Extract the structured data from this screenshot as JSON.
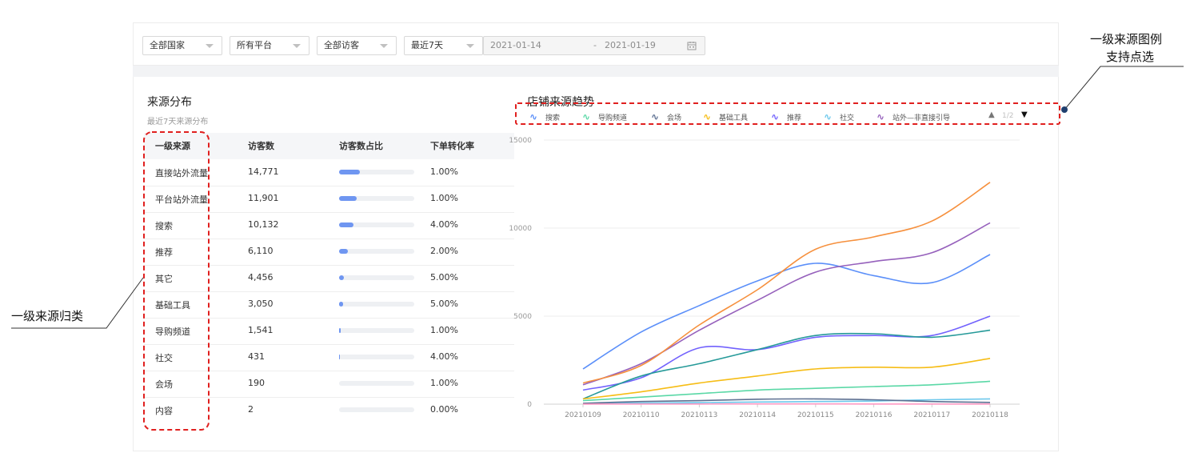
{
  "filters": {
    "country": "全部国家",
    "platform": "所有平台",
    "visitor": "全部访客",
    "period": "最近7天",
    "date_start": "2021-01-14",
    "date_sep": "-",
    "date_end": "2021-01-19"
  },
  "source_dist": {
    "title": "来源分布",
    "subtitle": "最近7天来源分布",
    "columns": [
      "一级来源",
      "访客数",
      "访客数占比",
      "下单转化率"
    ],
    "rows": [
      {
        "source": "直接站外流量",
        "visitors": "14,771",
        "share": 0.28,
        "conversion": "1.00%"
      },
      {
        "source": "平台站外流量",
        "visitors": "11,901",
        "share": 0.23,
        "conversion": "1.00%"
      },
      {
        "source": "搜索",
        "visitors": "10,132",
        "share": 0.19,
        "conversion": "4.00%"
      },
      {
        "source": "推荐",
        "visitors": "6,110",
        "share": 0.12,
        "conversion": "2.00%"
      },
      {
        "source": "其它",
        "visitors": "4,456",
        "share": 0.06,
        "conversion": "5.00%"
      },
      {
        "source": "基础工具",
        "visitors": "3,050",
        "share": 0.05,
        "conversion": "5.00%"
      },
      {
        "source": "导购频道",
        "visitors": "1,541",
        "share": 0.025,
        "conversion": "1.00%"
      },
      {
        "source": "社交",
        "visitors": "431",
        "share": 0.008,
        "conversion": "4.00%"
      },
      {
        "source": "会场",
        "visitors": "190",
        "share": 0.0,
        "conversion": "1.00%"
      },
      {
        "source": "内容",
        "visitors": "2",
        "share": 0.0,
        "conversion": "0.00%"
      }
    ]
  },
  "trend": {
    "title": "店铺来源趋势",
    "legend": [
      {
        "name": "搜索",
        "color": "#5b8ff9",
        "icon": "wave-icon"
      },
      {
        "name": "导购频道",
        "color": "#5ad8a6",
        "icon": "wave-icon"
      },
      {
        "name": "会场",
        "color": "#5d7092",
        "icon": "wave-icon"
      },
      {
        "name": "基础工具",
        "color": "#f6bd16",
        "icon": "wave-icon"
      },
      {
        "name": "推荐",
        "color": "#7262fd",
        "icon": "wave-icon"
      },
      {
        "name": "社交",
        "color": "#6dc8ec",
        "icon": "wave-icon"
      },
      {
        "name": "站外—非直接引导",
        "color": "#9661bc",
        "icon": "wave-icon"
      }
    ],
    "pager": "1/2"
  },
  "chart_data": {
    "type": "line",
    "x": [
      "20210109",
      "20210110",
      "20210113",
      "20210114",
      "20210115",
      "20210116",
      "20210117",
      "20210118"
    ],
    "yticks": [
      0,
      5000,
      10000,
      15000
    ],
    "ylim": [
      0,
      15000
    ],
    "series": [
      {
        "name": "搜索",
        "color": "#5b8ff9",
        "values": [
          2000,
          4100,
          5600,
          7000,
          8000,
          7300,
          6900,
          8500
        ]
      },
      {
        "name": "站外—非直接引导",
        "color": "#9661bc",
        "values": [
          1100,
          2300,
          4200,
          5900,
          7500,
          8100,
          8600,
          10300
        ]
      },
      {
        "color": "#f6903d",
        "values": [
          1200,
          2200,
          4500,
          6500,
          8800,
          9500,
          10400,
          12600
        ]
      },
      {
        "name": "推荐",
        "color": "#7262fd",
        "values": [
          800,
          1500,
          3200,
          3100,
          3800,
          3900,
          3900,
          5000
        ]
      },
      {
        "color": "#269a99",
        "values": [
          300,
          1600,
          2300,
          3100,
          3900,
          4000,
          3800,
          4200
        ]
      },
      {
        "name": "基础工具",
        "color": "#f6bd16",
        "values": [
          300,
          700,
          1200,
          1600,
          2000,
          2100,
          2100,
          2600
        ]
      },
      {
        "name": "导购频道",
        "color": "#5ad8a6",
        "values": [
          200,
          400,
          600,
          800,
          900,
          1000,
          1100,
          1300
        ]
      },
      {
        "name": "社交",
        "color": "#6dc8ec",
        "values": [
          30,
          60,
          90,
          120,
          150,
          180,
          250,
          300
        ]
      },
      {
        "name": "会场",
        "color": "#5d7092",
        "values": [
          50,
          150,
          200,
          280,
          300,
          250,
          150,
          100
        ]
      },
      {
        "color": "#ff99c3",
        "values": [
          5,
          10,
          10,
          15,
          15,
          10,
          10,
          10
        ]
      }
    ]
  },
  "annotations": {
    "legend_note_line1": "一级来源图例",
    "legend_note_line2": "支持点选",
    "category_note": "一级来源归类"
  }
}
